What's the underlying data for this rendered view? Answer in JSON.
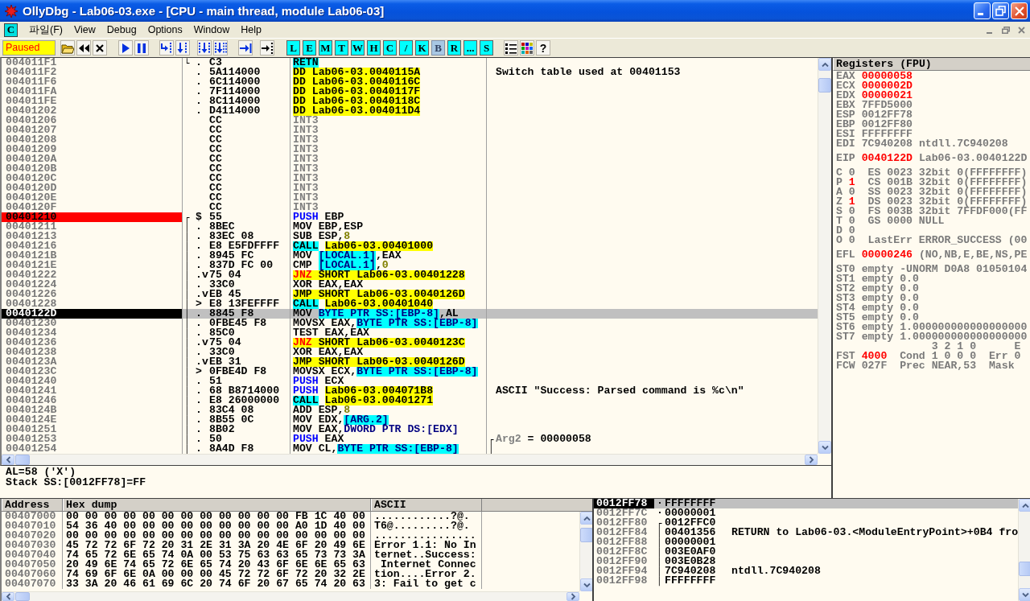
{
  "window": {
    "title": "OllyDbg - Lab06-03.exe - [CPU - main thread, module Lab06-03]"
  },
  "menu": {
    "system_label": "C",
    "items": [
      "파일(F)",
      "View",
      "Debug",
      "Options",
      "Window",
      "Help"
    ]
  },
  "toolbar": {
    "status": "Paused",
    "letter_buttons": [
      {
        "label": "L",
        "pressed": false
      },
      {
        "label": "E",
        "pressed": false
      },
      {
        "label": "M",
        "pressed": false
      },
      {
        "label": "T",
        "pressed": false
      },
      {
        "label": "W",
        "pressed": false
      },
      {
        "label": "H",
        "pressed": false
      },
      {
        "label": "C",
        "pressed": false
      },
      {
        "label": "/",
        "pressed": false
      },
      {
        "label": "K",
        "pressed": false
      },
      {
        "label": "B",
        "pressed": true
      },
      {
        "label": "R",
        "pressed": false
      },
      {
        "label": "...",
        "pressed": false
      },
      {
        "label": "S",
        "pressed": false
      }
    ],
    "help_label": "?"
  },
  "cpu": {
    "rows": [
      {
        "address": "004011F1",
        "breakpoint": false,
        "current": false,
        "selected": false,
        "bracket": "└",
        "marker": ".",
        "hex": "C3",
        "code": [
          {
            "text": "RETN",
            "kind": "ret"
          }
        ]
      },
      {
        "address": "004011F2",
        "breakpoint": false,
        "current": false,
        "selected": false,
        "marker": ".",
        "hex": "5A114000",
        "code": [
          {
            "text": "DD Lab06-03.0040115A",
            "kind": "data"
          }
        ],
        "comment": [
          {
            "text": "Switch table used at 00401153",
            "kind": "plain"
          }
        ]
      },
      {
        "address": "004011F6",
        "breakpoint": false,
        "current": false,
        "selected": false,
        "marker": ".",
        "hex": "6C114000",
        "code": [
          {
            "text": "DD Lab06-03.0040116C",
            "kind": "data"
          }
        ]
      },
      {
        "address": "004011FA",
        "breakpoint": false,
        "current": false,
        "selected": false,
        "marker": ".",
        "hex": "7F114000",
        "code": [
          {
            "text": "DD Lab06-03.0040117F",
            "kind": "data"
          }
        ]
      },
      {
        "address": "004011FE",
        "breakpoint": false,
        "current": false,
        "selected": false,
        "marker": ".",
        "hex": "8C114000",
        "code": [
          {
            "text": "DD Lab06-03.0040118C",
            "kind": "data"
          }
        ]
      },
      {
        "address": "00401202",
        "breakpoint": false,
        "current": false,
        "selected": false,
        "marker": ".",
        "hex": "D4114000",
        "code": [
          {
            "text": "DD Lab06-03.004011D4",
            "kind": "data"
          }
        ]
      },
      {
        "address": "00401206",
        "breakpoint": false,
        "current": false,
        "selected": false,
        "hex": "CC",
        "code": [
          {
            "text": "INT3",
            "kind": "filler"
          }
        ]
      },
      {
        "address": "00401207",
        "breakpoint": false,
        "current": false,
        "selected": false,
        "hex": "CC",
        "code": [
          {
            "text": "INT3",
            "kind": "filler"
          }
        ]
      },
      {
        "address": "00401208",
        "breakpoint": false,
        "current": false,
        "selected": false,
        "hex": "CC",
        "code": [
          {
            "text": "INT3",
            "kind": "filler"
          }
        ]
      },
      {
        "address": "00401209",
        "breakpoint": false,
        "current": false,
        "selected": false,
        "hex": "CC",
        "code": [
          {
            "text": "INT3",
            "kind": "filler"
          }
        ]
      },
      {
        "address": "0040120A",
        "breakpoint": false,
        "current": false,
        "selected": false,
        "hex": "CC",
        "code": [
          {
            "text": "INT3",
            "kind": "filler"
          }
        ]
      },
      {
        "address": "0040120B",
        "breakpoint": false,
        "current": false,
        "selected": false,
        "hex": "CC",
        "code": [
          {
            "text": "INT3",
            "kind": "filler"
          }
        ]
      },
      {
        "address": "0040120C",
        "breakpoint": false,
        "current": false,
        "selected": false,
        "hex": "CC",
        "code": [
          {
            "text": "INT3",
            "kind": "filler"
          }
        ]
      },
      {
        "address": "0040120D",
        "breakpoint": false,
        "current": false,
        "selected": false,
        "hex": "CC",
        "code": [
          {
            "text": "INT3",
            "kind": "filler"
          }
        ]
      },
      {
        "address": "0040120E",
        "breakpoint": false,
        "current": false,
        "selected": false,
        "hex": "CC",
        "code": [
          {
            "text": "INT3",
            "kind": "filler"
          }
        ]
      },
      {
        "address": "0040120F",
        "breakpoint": false,
        "current": false,
        "selected": false,
        "hex": "CC",
        "code": [
          {
            "text": "INT3",
            "kind": "filler"
          }
        ]
      },
      {
        "address": "00401210",
        "breakpoint": true,
        "current": false,
        "selected": false,
        "bracket": "┌",
        "marker": "$",
        "hex": "55",
        "code": [
          {
            "text": "PUSH",
            "kind": "push"
          },
          {
            "text": " EBP",
            "kind": "plain"
          }
        ]
      },
      {
        "address": "00401211",
        "breakpoint": false,
        "current": false,
        "selected": false,
        "bracket": "│",
        "marker": ".",
        "hex": "8BEC",
        "code": [
          {
            "text": "MOV EBP,ESP",
            "kind": "plain"
          }
        ]
      },
      {
        "address": "00401213",
        "breakpoint": false,
        "current": false,
        "selected": false,
        "bracket": "│",
        "marker": ".",
        "hex": "83EC 08",
        "code": [
          {
            "text": "SUB ESP,",
            "kind": "plain"
          },
          {
            "text": "8",
            "kind": "constant"
          }
        ]
      },
      {
        "address": "00401216",
        "breakpoint": false,
        "current": false,
        "selected": false,
        "bracket": "│",
        "marker": ".",
        "hex": "E8 E5FDFFFF",
        "code": [
          {
            "text": "CALL",
            "kind": "call"
          },
          {
            "text": " Lab06-03.00401000",
            "kind": "target"
          }
        ]
      },
      {
        "address": "0040121B",
        "breakpoint": false,
        "current": false,
        "selected": false,
        "bracket": "│",
        "marker": ".",
        "hex": "8945 FC",
        "code": [
          {
            "text": "MOV",
            "kind": "plain"
          },
          {
            "text": " [LOCAL.1]",
            "kind": "memory"
          },
          {
            "text": ",EAX",
            "kind": "plain"
          }
        ]
      },
      {
        "address": "0040121E",
        "breakpoint": false,
        "current": false,
        "selected": false,
        "bracket": "│",
        "marker": ".",
        "hex": "837D FC 00",
        "code": [
          {
            "text": "CMP",
            "kind": "plain"
          },
          {
            "text": " [LOCAL.1]",
            "kind": "memory"
          },
          {
            "text": ",",
            "kind": "plain"
          },
          {
            "text": "0",
            "kind": "constant"
          }
        ]
      },
      {
        "address": "00401222",
        "breakpoint": false,
        "current": false,
        "selected": false,
        "bracket": "│",
        "marker": ".v",
        "hex": "75 04",
        "code": [
          {
            "text": "JNZ ",
            "kind": "jcc"
          },
          {
            "text": "SHORT Lab06-03.00401228",
            "kind": "jump"
          }
        ]
      },
      {
        "address": "00401224",
        "breakpoint": false,
        "current": false,
        "selected": false,
        "bracket": "│",
        "marker": ".",
        "hex": "33C0",
        "code": [
          {
            "text": "XOR EAX,EAX",
            "kind": "plain"
          }
        ]
      },
      {
        "address": "00401226",
        "breakpoint": false,
        "current": false,
        "selected": false,
        "bracket": "│",
        "marker": ".v",
        "hex": "EB 45",
        "code": [
          {
            "text": "JMP SHORT Lab06-03.0040126D",
            "kind": "jump"
          }
        ]
      },
      {
        "address": "00401228",
        "breakpoint": false,
        "current": false,
        "selected": false,
        "bracket": "│",
        "marker": ">",
        "hex": "E8 13FEFFFF",
        "code": [
          {
            "text": "CALL",
            "kind": "call"
          },
          {
            "text": " Lab06-03.00401040",
            "kind": "target"
          }
        ]
      },
      {
        "address": "0040122D",
        "breakpoint": false,
        "current": true,
        "selected": true,
        "bracket": "│",
        "marker": ".",
        "hex": "8845 F8",
        "code": [
          {
            "text": "MOV",
            "kind": "plain"
          },
          {
            "text": " BYTE PTR SS:[EBP-8]",
            "kind": "memory"
          },
          {
            "text": ",AL",
            "kind": "plain"
          }
        ]
      },
      {
        "address": "00401230",
        "breakpoint": false,
        "current": false,
        "selected": false,
        "bracket": "│",
        "marker": ".",
        "hex": "0FBE45 F8",
        "code": [
          {
            "text": "MOVSX EAX,",
            "kind": "plain"
          },
          {
            "text": "BYTE PTR SS:[EBP-8]",
            "kind": "memory"
          }
        ]
      },
      {
        "address": "00401234",
        "breakpoint": false,
        "current": false,
        "selected": false,
        "bracket": "│",
        "marker": ".",
        "hex": "85C0",
        "code": [
          {
            "text": "TEST EAX,EAX",
            "kind": "plain"
          }
        ]
      },
      {
        "address": "00401236",
        "breakpoint": false,
        "current": false,
        "selected": false,
        "bracket": "│",
        "marker": ".v",
        "hex": "75 04",
        "code": [
          {
            "text": "JNZ ",
            "kind": "jcc"
          },
          {
            "text": "SHORT Lab06-03.0040123C",
            "kind": "jump"
          }
        ]
      },
      {
        "address": "00401238",
        "breakpoint": false,
        "current": false,
        "selected": false,
        "bracket": "│",
        "marker": ".",
        "hex": "33C0",
        "code": [
          {
            "text": "XOR EAX,EAX",
            "kind": "plain"
          }
        ]
      },
      {
        "address": "0040123A",
        "breakpoint": false,
        "current": false,
        "selected": false,
        "bracket": "│",
        "marker": ".v",
        "hex": "EB 31",
        "code": [
          {
            "text": "JMP SHORT Lab06-03.0040126D",
            "kind": "jump"
          }
        ]
      },
      {
        "address": "0040123C",
        "breakpoint": false,
        "current": false,
        "selected": false,
        "bracket": "│",
        "marker": ">",
        "hex": "0FBE4D F8",
        "code": [
          {
            "text": "MOVSX ECX,",
            "kind": "plain"
          },
          {
            "text": "BYTE PTR SS:[EBP-8]",
            "kind": "memory"
          }
        ]
      },
      {
        "address": "00401240",
        "breakpoint": false,
        "current": false,
        "selected": false,
        "bracket": "│",
        "marker": ".",
        "hex": "51",
        "code": [
          {
            "text": "PUSH",
            "kind": "push"
          },
          {
            "text": " ECX",
            "kind": "plain"
          }
        ]
      },
      {
        "address": "00401241",
        "breakpoint": false,
        "current": false,
        "selected": false,
        "bracket": "│",
        "marker": ".",
        "hex": "68 B8714000",
        "code": [
          {
            "text": "PUSH",
            "kind": "push"
          },
          {
            "text": " Lab06-03.004071B8",
            "kind": "target"
          }
        ],
        "comment": [
          {
            "text": "ASCII \"Success: Parsed command is %c\\n\"",
            "kind": "plain"
          }
        ]
      },
      {
        "address": "00401246",
        "breakpoint": false,
        "current": false,
        "selected": false,
        "bracket": "│",
        "marker": ".",
        "hex": "E8 26000000",
        "code": [
          {
            "text": "CALL",
            "kind": "call"
          },
          {
            "text": " Lab06-03.00401271",
            "kind": "target"
          }
        ]
      },
      {
        "address": "0040124B",
        "breakpoint": false,
        "current": false,
        "selected": false,
        "bracket": "│",
        "marker": ".",
        "hex": "83C4 08",
        "code": [
          {
            "text": "ADD ESP,",
            "kind": "plain"
          },
          {
            "text": "8",
            "kind": "constant"
          }
        ]
      },
      {
        "address": "0040124E",
        "breakpoint": false,
        "current": false,
        "selected": false,
        "bracket": "│",
        "marker": ".",
        "hex": "8B55 0C",
        "code": [
          {
            "text": "MOV EDX,",
            "kind": "plain"
          },
          {
            "text": "[ARG.2]",
            "kind": "memory"
          }
        ]
      },
      {
        "address": "00401251",
        "breakpoint": false,
        "current": false,
        "selected": false,
        "bracket": "│",
        "marker": ".",
        "hex": "8B02",
        "code": [
          {
            "text": "MOV EAX,",
            "kind": "plain"
          },
          {
            "text": "DWORD PTR DS:[EDX]",
            "kind": "pointer"
          }
        ]
      },
      {
        "address": "00401253",
        "breakpoint": false,
        "current": false,
        "selected": false,
        "bracket": "│",
        "marker": ".",
        "hex": "50",
        "code": [
          {
            "text": "PUSH",
            "kind": "push"
          },
          {
            "text": " EAX",
            "kind": "plain"
          }
        ],
        "comment_bracket": "┌",
        "comment": [
          {
            "text": "Arg2",
            "kind": "arg"
          },
          {
            "text": " = 00000058",
            "kind": "plain"
          }
        ]
      },
      {
        "address": "00401254",
        "breakpoint": false,
        "current": false,
        "selected": false,
        "bracket": "│",
        "marker": ".",
        "hex": "8A4D F8",
        "code": [
          {
            "text": "MOV CL,",
            "kind": "plain"
          },
          {
            "text": "BYTE PTR SS:[EBP-8]",
            "kind": "memory"
          }
        ],
        "comment_bracket": "│"
      }
    ],
    "info": [
      "AL=58 ('X')",
      "Stack SS:[0012FF78]=FF"
    ]
  },
  "registers": {
    "title": "Registers (FPU)",
    "groups": [
      {
        "lines": [
          {
            "kind": "register",
            "name": "EAX",
            "value": "00000058",
            "changed": true
          },
          {
            "kind": "register",
            "name": "ECX",
            "value": "0000002D",
            "changed": true
          },
          {
            "kind": "register",
            "name": "EDX",
            "value": "00000021",
            "changed": true
          },
          {
            "kind": "register",
            "name": "EBX",
            "value": "7FFD5000",
            "changed": false
          },
          {
            "kind": "register",
            "name": "ESP",
            "value": "0012FF78",
            "changed": false
          },
          {
            "kind": "register",
            "name": "EBP",
            "value": "0012FF80",
            "changed": false
          },
          {
            "kind": "register",
            "name": "ESI",
            "value": "FFFFFFFF",
            "changed": false
          },
          {
            "kind": "register",
            "name": "EDI",
            "value": "7C940208",
            "changed": false,
            "comment": "ntdll.7C940208"
          }
        ]
      },
      {
        "lines": [
          {
            "kind": "register",
            "name": "EIP",
            "value": "0040122D",
            "changed": true,
            "comment": "Lab06-03.0040122D"
          }
        ]
      },
      {
        "lines": [
          {
            "kind": "flag",
            "name": "C",
            "value": "0",
            "changed": false,
            "text": "ES 0023 32bit 0(FFFFFFFF)"
          },
          {
            "kind": "flag",
            "name": "P",
            "value": "1",
            "changed": true,
            "text": "CS 001B 32bit 0(FFFFFFFF)"
          },
          {
            "kind": "flag",
            "name": "A",
            "value": "0",
            "changed": false,
            "text": "SS 0023 32bit 0(FFFFFFFF)"
          },
          {
            "kind": "flag",
            "name": "Z",
            "value": "1",
            "changed": true,
            "text": "DS 0023 32bit 0(FFFFFFFF)"
          },
          {
            "kind": "flag",
            "name": "S",
            "value": "0",
            "changed": false,
            "text": "FS 003B 32bit 7FFDF000(FF"
          },
          {
            "kind": "flag",
            "name": "T",
            "value": "0",
            "changed": false,
            "text": "GS 0000 NULL"
          },
          {
            "kind": "flag",
            "name": "D",
            "value": "0",
            "changed": false
          },
          {
            "kind": "flag",
            "name": "O",
            "value": "0",
            "changed": false,
            "text": "LastErr ERROR_SUCCESS (00"
          }
        ]
      },
      {
        "lines": [
          {
            "kind": "register",
            "name": "EFL",
            "value": "00000246",
            "changed": true,
            "comment": "(NO,NB,E,BE,NS,PE"
          }
        ]
      },
      {
        "lines": [
          {
            "kind": "fpu",
            "name": "ST0",
            "text": "empty -UNORM D0A8 01050104"
          },
          {
            "kind": "fpu",
            "name": "ST1",
            "text": "empty 0.0"
          },
          {
            "kind": "fpu",
            "name": "ST2",
            "text": "empty 0.0"
          },
          {
            "kind": "fpu",
            "name": "ST3",
            "text": "empty 0.0"
          },
          {
            "kind": "fpu",
            "name": "ST4",
            "text": "empty 0.0"
          },
          {
            "kind": "fpu",
            "name": "ST5",
            "text": "empty 0.0"
          },
          {
            "kind": "fpu",
            "name": "ST6",
            "text": "empty 1.000000000000000000"
          },
          {
            "kind": "fpu",
            "name": "ST7",
            "text": "empty 1.000000000000000000"
          },
          {
            "kind": "legend",
            "text": "3 2 1 0      E"
          },
          {
            "kind": "status",
            "name": "FST",
            "value": "4000",
            "changed": true,
            "text": "Cond 1 0 0 0  Err 0"
          },
          {
            "kind": "status",
            "name": "FCW",
            "value": "027F",
            "changed": false,
            "text": "Prec NEAR,53  Mask"
          }
        ]
      }
    ]
  },
  "dump": {
    "columns": [
      "Address",
      "Hex dump",
      "ASCII"
    ],
    "rows": [
      {
        "address": "00407000",
        "hex": "00 00 00 00 00 00 00 00 00 00 00 00 FB 1C 40 00",
        "ascii": "............?@."
      },
      {
        "address": "00407010",
        "hex": "54 36 40 00 00 00 00 00 00 00 00 00 A0 1D 40 00",
        "ascii": "T6@.........?@."
      },
      {
        "address": "00407020",
        "hex": "00 00 00 00 00 00 00 00 00 00 00 00 00 00 00 00",
        "ascii": "................"
      },
      {
        "address": "00407030",
        "hex": "45 72 72 6F 72 20 31 2E 31 3A 20 4E 6F 20 49 6E",
        "ascii": "Error 1.1: No In"
      },
      {
        "address": "00407040",
        "hex": "74 65 72 6E 65 74 0A 00 53 75 63 63 65 73 73 3A",
        "ascii": "ternet..Success:"
      },
      {
        "address": "00407050",
        "hex": "20 49 6E 74 65 72 6E 65 74 20 43 6F 6E 6E 65 63",
        "ascii": " Internet Connec"
      },
      {
        "address": "00407060",
        "hex": "74 69 6F 6E 0A 00 00 00 45 72 72 6F 72 20 32 2E",
        "ascii": "tion....Error 2."
      },
      {
        "address": "00407070",
        "hex": "33 3A 20 46 61 69 6C 20 74 6F 20 67 65 74 20 63",
        "ascii": "3: Fail to get c"
      }
    ]
  },
  "stack": {
    "rows": [
      {
        "address": "0012FF78",
        "current": true,
        "selected": true,
        "marker": "·",
        "value": "FFFFFFFF"
      },
      {
        "address": "0012FF7C",
        "current": false,
        "selected": false,
        "marker": "·",
        "value": "00000001"
      },
      {
        "address": "0012FF80",
        "current": false,
        "selected": false,
        "bracket": "┌",
        "value": "0012FFC0"
      },
      {
        "address": "0012FF84",
        "current": false,
        "selected": false,
        "bracket": "│",
        "value": "00401356",
        "comment": "RETURN to Lab06-03.<ModuleEntryPoint>+0B4 fro"
      },
      {
        "address": "0012FF88",
        "current": false,
        "selected": false,
        "bracket": "│",
        "value": "00000001"
      },
      {
        "address": "0012FF8C",
        "current": false,
        "selected": false,
        "bracket": "│",
        "value": "003E0AF0"
      },
      {
        "address": "0012FF90",
        "current": false,
        "selected": false,
        "bracket": "│",
        "value": "003E0B28"
      },
      {
        "address": "0012FF94",
        "current": false,
        "selected": false,
        "bracket": "│",
        "value": "7C940208",
        "comment": "ntdll.7C940208"
      },
      {
        "address": "0012FF98",
        "current": false,
        "selected": false,
        "bracket": "│",
        "value": "FFFFFFFF"
      }
    ]
  }
}
